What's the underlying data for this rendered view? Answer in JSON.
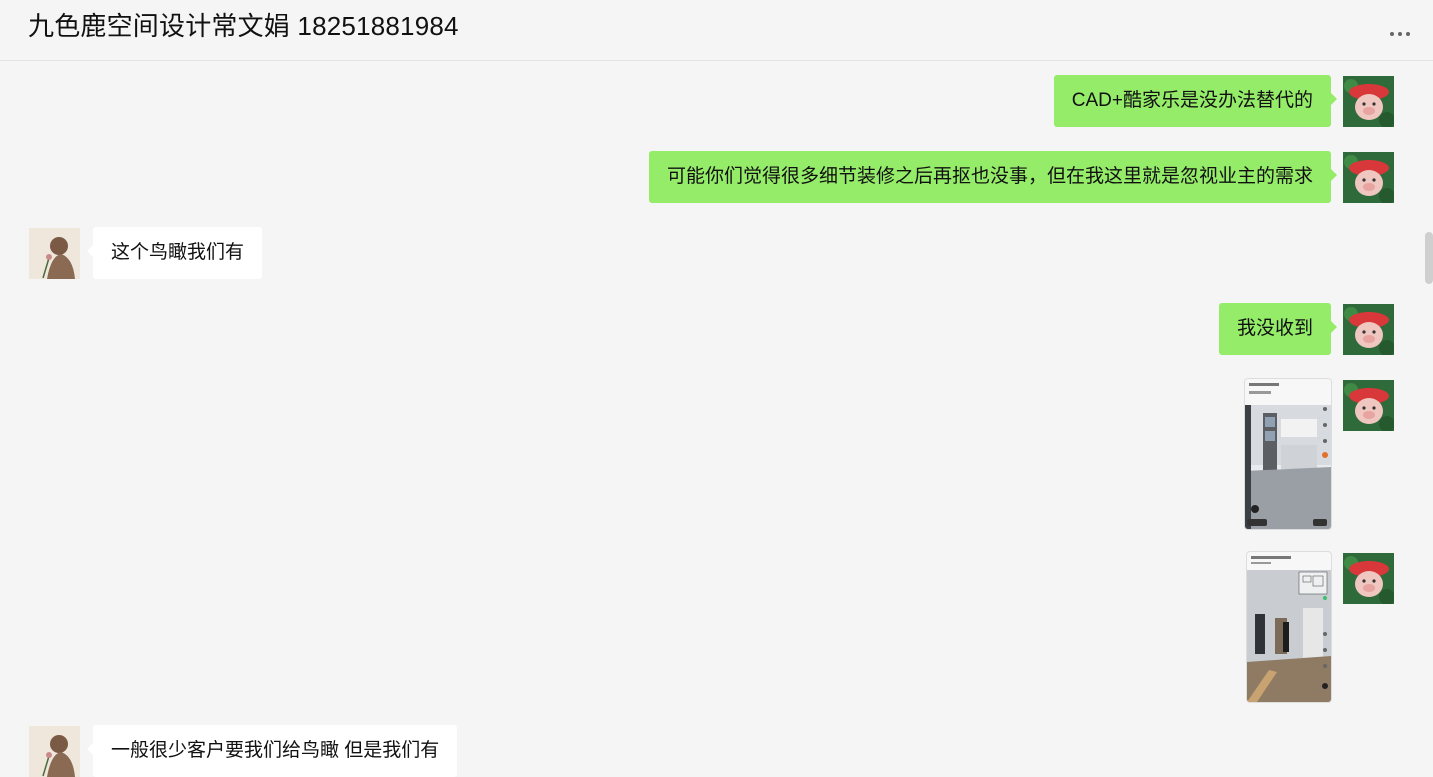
{
  "header": {
    "title": "九色鹿空间设计常文娟 18251881984",
    "more_icon": "more-dots-icon"
  },
  "messages": [
    {
      "side": "out",
      "type": "text",
      "text": "CAD+酷家乐是没办法替代的"
    },
    {
      "side": "out",
      "type": "text",
      "text": "可能你们觉得很多细节装修之后再抠也没事，但在我这里就是忽视业主的需求"
    },
    {
      "side": "in",
      "type": "text",
      "text": "这个鸟瞰我们有"
    },
    {
      "side": "out",
      "type": "text",
      "text": "我没收到"
    },
    {
      "side": "out",
      "type": "image",
      "description": "kitchen-render-screenshot"
    },
    {
      "side": "out",
      "type": "image",
      "description": "hallway-render-screenshot"
    },
    {
      "side": "in",
      "type": "text",
      "text": "一般很少客户要我们给鸟瞰 但是我们有"
    }
  ],
  "colors": {
    "out_bubble": "#95ec69",
    "in_bubble": "#ffffff",
    "background": "#f5f5f5"
  }
}
